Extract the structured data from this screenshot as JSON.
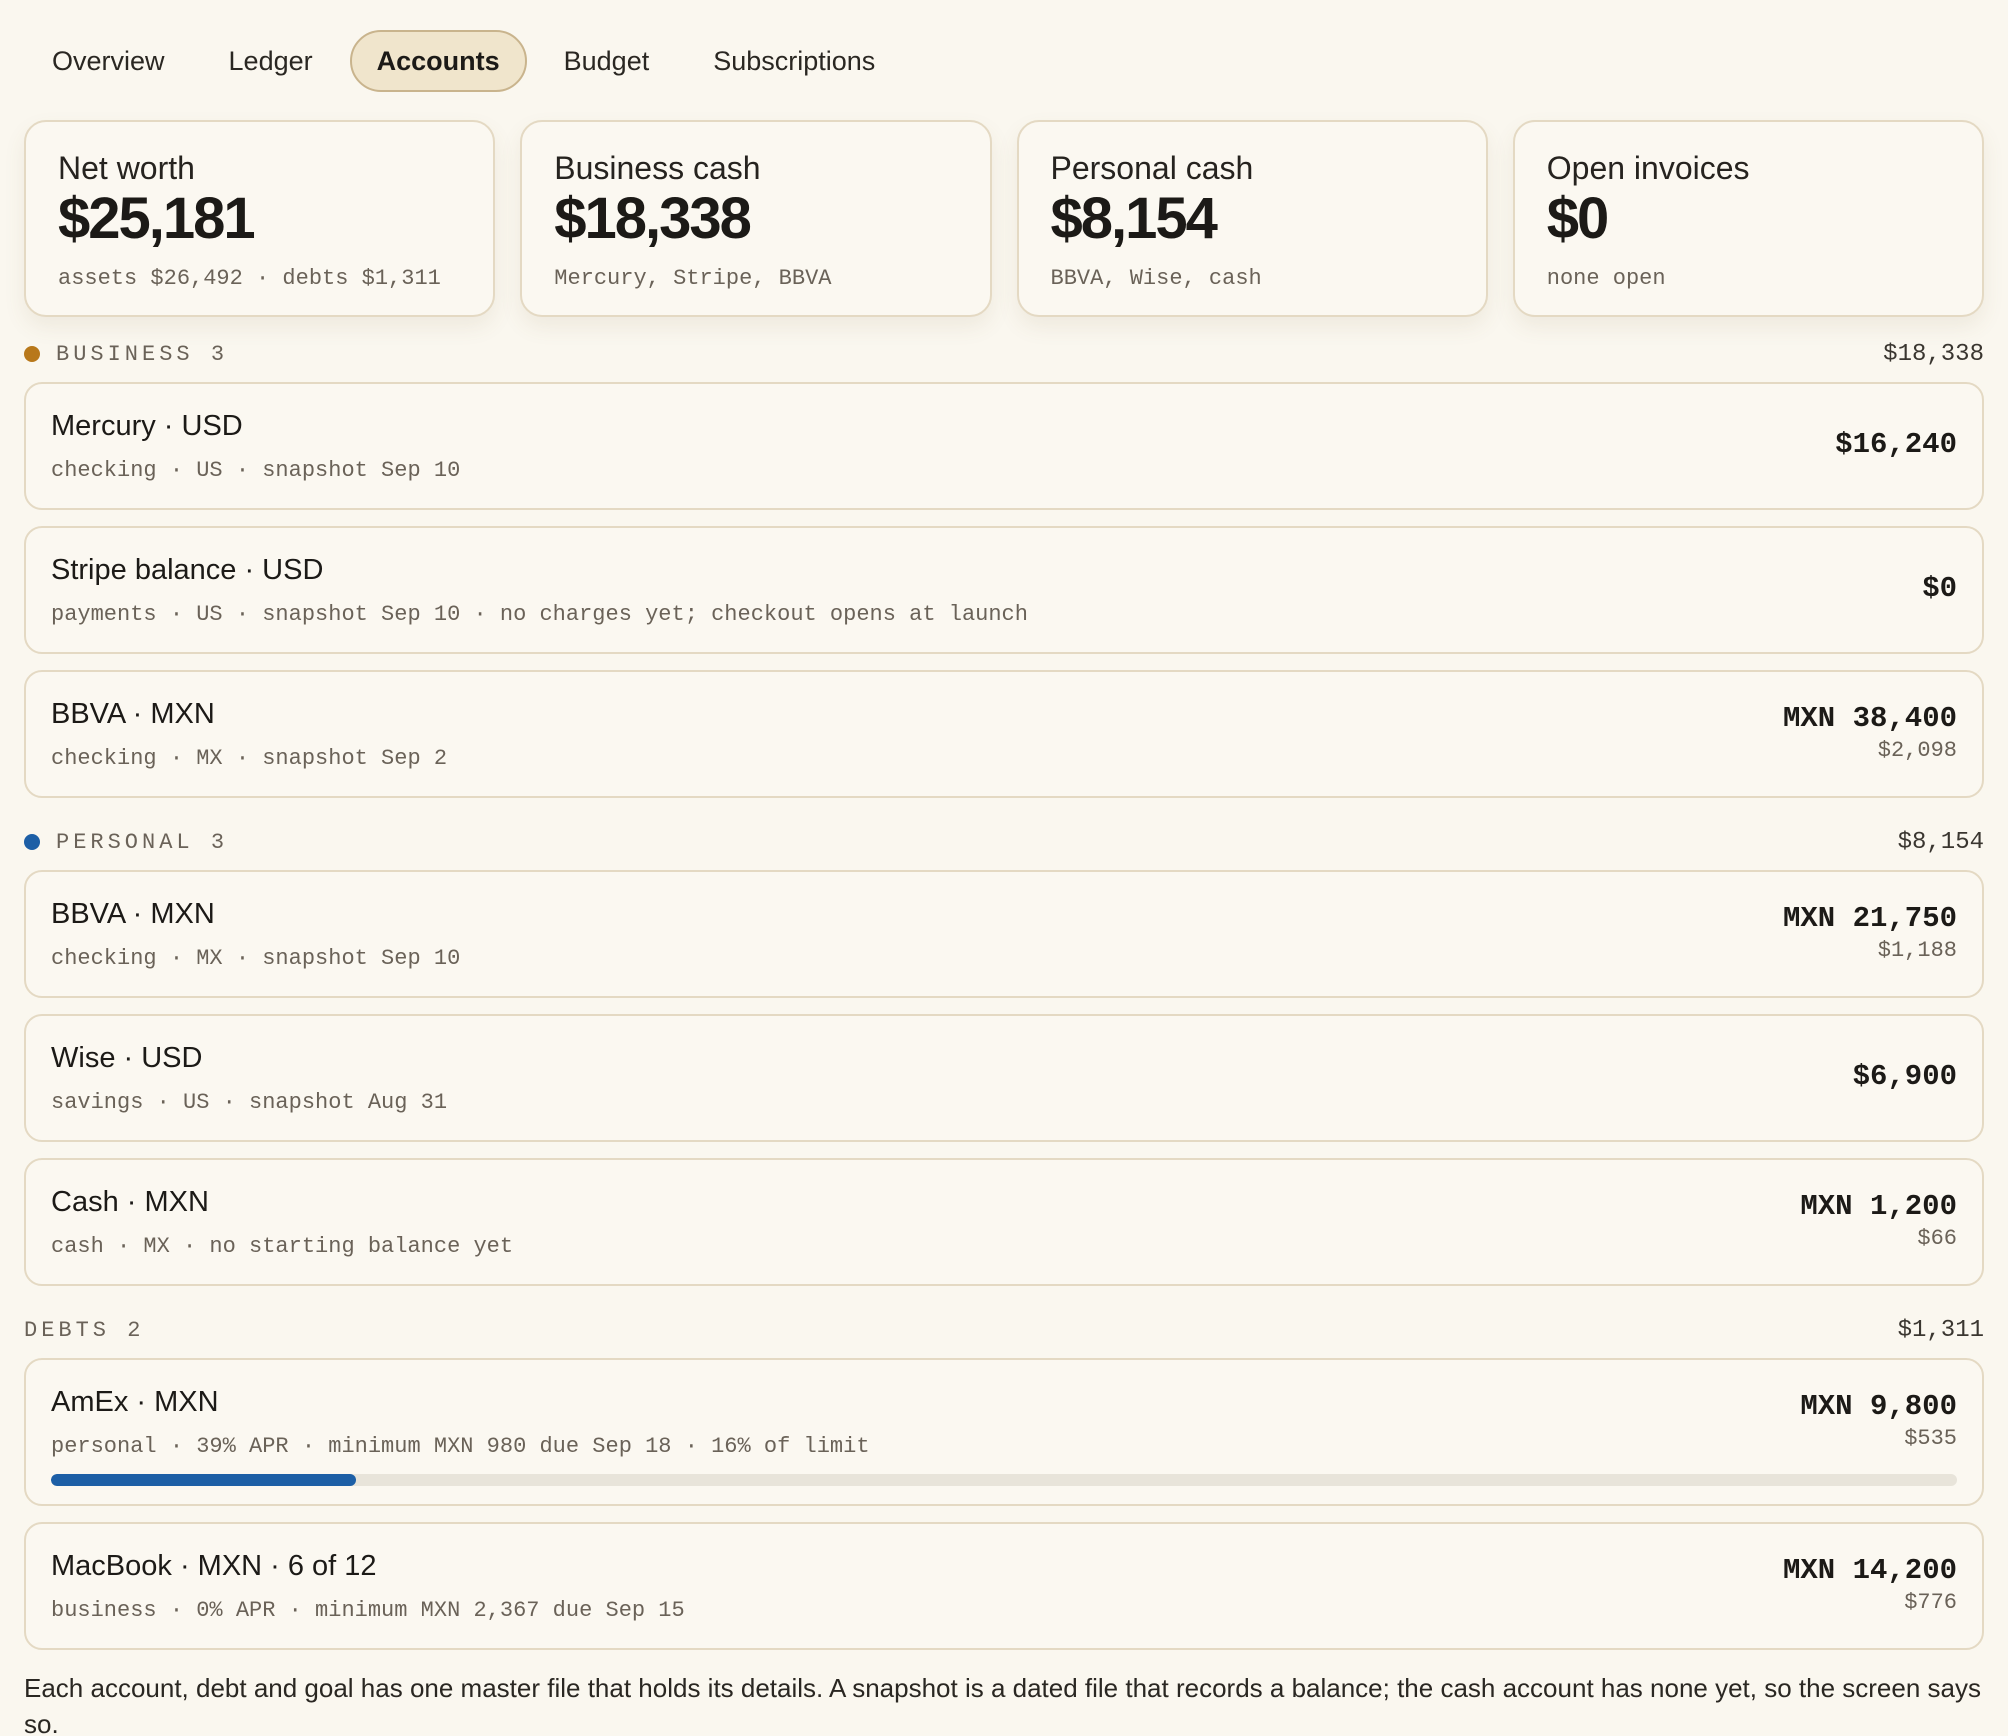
{
  "tabs": [
    {
      "label": "Overview"
    },
    {
      "label": "Ledger"
    },
    {
      "label": "Accounts"
    },
    {
      "label": "Budget"
    },
    {
      "label": "Subscriptions"
    }
  ],
  "active_tab": "Accounts",
  "summary": [
    {
      "title": "Net worth",
      "value": "$25,181",
      "sub": "assets $26,492 · debts $1,311"
    },
    {
      "title": "Business cash",
      "value": "$18,338",
      "sub": "Mercury, Stripe, BBVA"
    },
    {
      "title": "Personal cash",
      "value": "$8,154",
      "sub": "BBVA, Wise, cash"
    },
    {
      "title": "Open invoices",
      "value": "$0",
      "sub": "none open"
    }
  ],
  "sections": {
    "business": {
      "label": "BUSINESS 3",
      "total": "$18,338",
      "dot_color": "#b8781a"
    },
    "personal": {
      "label": "PERSONAL 3",
      "total": "$8,154",
      "dot_color": "#1d5fa6"
    },
    "debts": {
      "label": "DEBTS 2",
      "total": "$1,311"
    }
  },
  "accounts": {
    "mercury": {
      "name": "Mercury · USD",
      "meta": "checking · US · snapshot Sep 10",
      "amount": "$16,240"
    },
    "stripe": {
      "name": "Stripe balance · USD",
      "meta": "payments · US · snapshot Sep 10 · no charges yet; checkout opens at launch",
      "amount": "$0"
    },
    "bbva_business": {
      "name": "BBVA · MXN",
      "meta": "checking · MX · snapshot Sep 2",
      "amount": "MXN 38,400",
      "usd": "$2,098"
    },
    "bbva_personal": {
      "name": "BBVA · MXN",
      "meta": "checking · MX · snapshot Sep 10",
      "amount": "MXN 21,750",
      "usd": "$1,188"
    },
    "wise": {
      "name": "Wise · USD",
      "meta": "savings · US · snapshot Aug 31",
      "amount": "$6,900"
    },
    "cash": {
      "name": "Cash · MXN",
      "meta": "cash · MX · no starting balance yet",
      "amount": "MXN 1,200",
      "usd": "$66"
    }
  },
  "debts": {
    "amex": {
      "name": "AmEx · MXN",
      "meta": "personal · 39% APR · minimum MXN 980 due Sep 18 · 16% of limit",
      "amount": "MXN 9,800",
      "usd": "$535",
      "utilization": 0.16,
      "bar_color": "#1d5fa6"
    },
    "macbook": {
      "name": "MacBook · MXN · 6 of 12",
      "meta": "business · 0% APR · minimum MXN 2,367 due Sep 15",
      "amount": "MXN 14,200",
      "usd": "$776"
    }
  },
  "footnote": "Each account, debt and goal has one master file that holds its details. A snapshot is a dated file that records a balance; the cash account has none yet, so the screen says so."
}
